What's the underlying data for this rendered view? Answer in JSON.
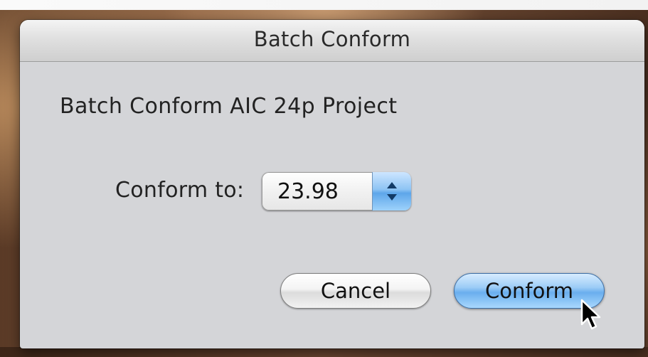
{
  "dialog": {
    "title": "Batch Conform",
    "heading": "Batch Conform AIC 24p Project"
  },
  "conform_to": {
    "label": "Conform to:",
    "selected_value": "23.98"
  },
  "buttons": {
    "cancel_label": "Cancel",
    "conform_label": "Conform"
  },
  "colors": {
    "dialog_bg": "#d4d5d8",
    "default_button_accent": "#6aaeee"
  },
  "icons": {
    "popup": "up-down-arrows-icon",
    "cursor": "arrow-cursor-icon"
  }
}
